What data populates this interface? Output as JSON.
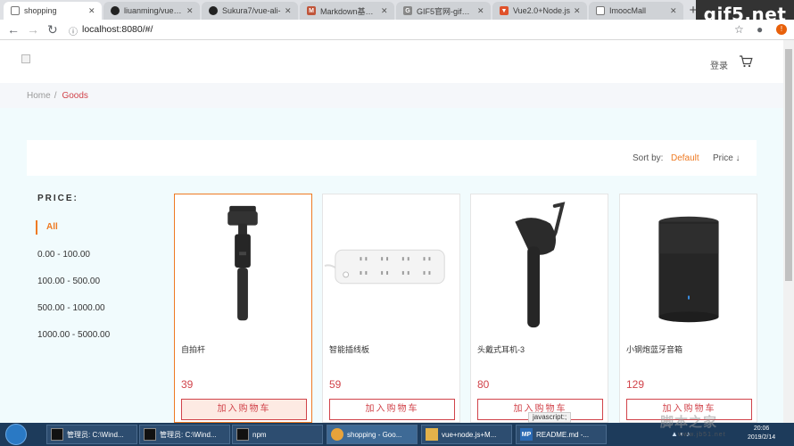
{
  "browser": {
    "tabs": [
      {
        "title": "shopping",
        "icon": "page-icon",
        "active": true
      },
      {
        "title": "liuanming/vue-m",
        "icon": "github-icon"
      },
      {
        "title": "Sukura7/vue-ali-",
        "icon": "github-icon"
      },
      {
        "title": "Markdown基本语",
        "icon": "markdown-icon"
      },
      {
        "title": "GIF5官网-gif在线",
        "icon": "gif-icon"
      },
      {
        "title": "Vue2.0+Node.js",
        "icon": "vue-icon"
      },
      {
        "title": "ImoocMall",
        "icon": "page-icon"
      }
    ],
    "new_tab": "+",
    "watermark": "gif5.net",
    "url": "localhost:8080/#/"
  },
  "header": {
    "login": "登录"
  },
  "breadcrumb": {
    "home": "Home",
    "separator": "/",
    "current": "Goods"
  },
  "sort": {
    "label": "Sort by:",
    "default": "Default",
    "price": "Price ↓"
  },
  "filter": {
    "title": "PRICE:",
    "items": [
      "All",
      "0.00 - 100.00",
      "100.00 - 500.00",
      "500.00 - 1000.00",
      "1000.00 - 5000.00"
    ],
    "active_index": 0
  },
  "products": [
    {
      "name": "自拍杆",
      "price": "39",
      "button": "加入购物车",
      "image": "selfie-stick-image"
    },
    {
      "name": "智能插线板",
      "price": "59",
      "button": "加入购物车",
      "image": "power-strip-image"
    },
    {
      "name": "头戴式耳机-3",
      "price": "80",
      "button": "加入购物车",
      "image": "earpiece-image"
    },
    {
      "name": "小钢炮蓝牙音箱",
      "price": "129",
      "button": "加入购物车",
      "image": "speaker-image"
    }
  ],
  "status_bar": "javascript:;",
  "taskbar": {
    "items": [
      {
        "label": "管理员: C:\\Wind...",
        "icon": "cmd-icon"
      },
      {
        "label": "管理员: C:\\Wind...",
        "icon": "cmd-icon"
      },
      {
        "label": "npm",
        "icon": "cmd-icon"
      },
      {
        "label": "shopping - Goo...",
        "icon": "chrome-icon",
        "active": true
      },
      {
        "label": "vue+node.js+M...",
        "icon": "folder-icon"
      },
      {
        "label": "README.md -...",
        "icon": "markdownpad-icon"
      }
    ],
    "time": "20:06",
    "date": "2019/2/14"
  },
  "watermark_bottom": {
    "text": "脚本之家",
    "url": "www.jb51.net"
  },
  "colors": {
    "accent": "#ee7a23",
    "price": "#d1434a",
    "background": "#f1fbfd"
  }
}
